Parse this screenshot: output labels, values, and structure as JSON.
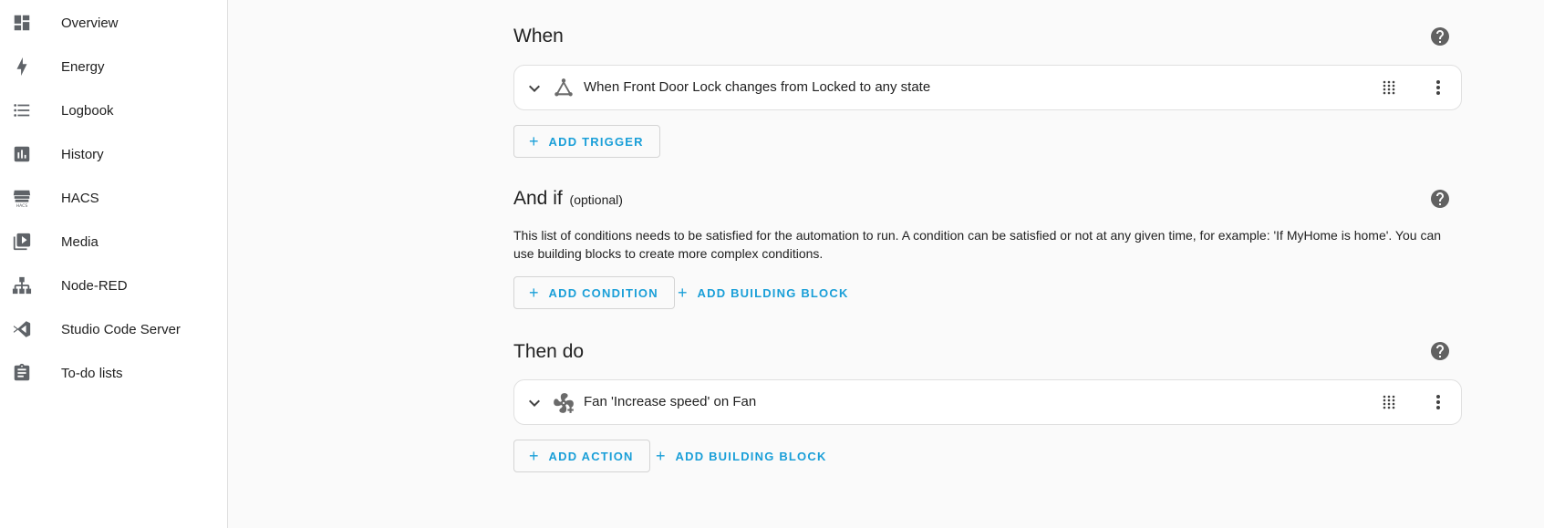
{
  "sidebar": {
    "items": [
      {
        "label": "Overview",
        "icon": "dashboard-icon"
      },
      {
        "label": "Energy",
        "icon": "lightning-bolt-icon"
      },
      {
        "label": "Logbook",
        "icon": "format-list-bulleted-icon"
      },
      {
        "label": "History",
        "icon": "chart-box-icon"
      },
      {
        "label": "HACS",
        "icon": "hacs-store-icon"
      },
      {
        "label": "Media",
        "icon": "play-box-multiple-icon"
      },
      {
        "label": "Node-RED",
        "icon": "sitemap-icon"
      },
      {
        "label": "Studio Code Server",
        "icon": "vscode-icon"
      },
      {
        "label": "To-do lists",
        "icon": "clipboard-list-icon"
      }
    ]
  },
  "when": {
    "title": "When",
    "trigger_label": "When Front Door Lock changes from Locked to any state",
    "add_trigger": "ADD TRIGGER"
  },
  "and_if": {
    "title": "And if",
    "optional": "(optional)",
    "description": "This list of conditions needs to be satisfied for the automation to run. A condition can be satisfied or not at any given time, for example: 'If MyHome is home'. You can use building blocks to create more complex conditions.",
    "add_condition": "ADD CONDITION",
    "add_building_block": "ADD BUILDING BLOCK"
  },
  "then_do": {
    "title": "Then do",
    "action_label": "Fan 'Increase speed' on Fan",
    "add_action": "ADD ACTION",
    "add_building_block": "ADD BUILDING BLOCK"
  },
  "colors": {
    "accent": "#1a9fd8",
    "background": "#fafafa",
    "card": "#ffffff",
    "icon": "#616161"
  }
}
